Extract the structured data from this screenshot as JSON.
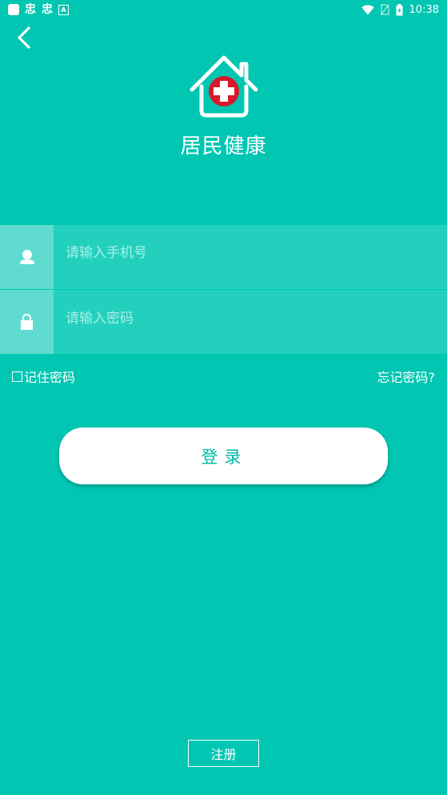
{
  "status_bar": {
    "left_icons": [
      "app-icon",
      "bug-icon",
      "bug-icon",
      "a-icon"
    ],
    "glyph_1": "忠",
    "glyph_2": "忠",
    "a_label": "A",
    "time": "10:38"
  },
  "header": {
    "back_icon": "chevron-left-icon",
    "logo_icon": "house-medical-cross-icon",
    "title": "居民健康"
  },
  "form": {
    "phone": {
      "icon": "user-icon",
      "placeholder": "请输入手机号",
      "value": ""
    },
    "password": {
      "icon": "lock-icon",
      "placeholder": "请输入密码",
      "value": ""
    },
    "remember_label": "记住密码",
    "remember_checked": false,
    "forgot_label": "忘记密码?",
    "login_label": "登录"
  },
  "footer": {
    "register_label": "注册"
  },
  "colors": {
    "background": "#00c6b2",
    "field_bg": "#23d0bd",
    "icon_box_bg": "#5fdccf",
    "cross_red": "#d7192a",
    "button_text": "#00b9a6"
  }
}
